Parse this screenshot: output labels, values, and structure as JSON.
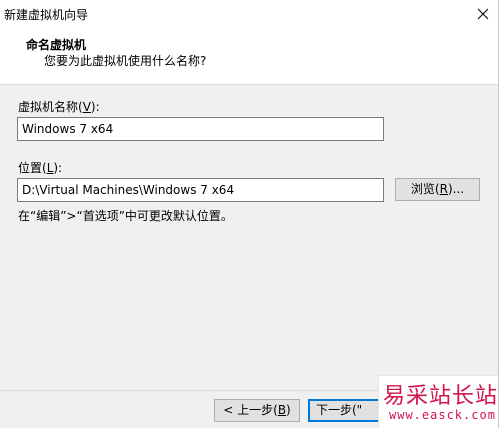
{
  "window": {
    "title": "新建虚拟机向导"
  },
  "header": {
    "title": "命名虚拟机",
    "subtitle": "您要为此虚拟机使用什么名称?"
  },
  "name_field": {
    "label_prefix": "虚拟机名称(",
    "label_key": "V",
    "label_suffix": "):",
    "value": "Windows 7 x64"
  },
  "location_field": {
    "label_prefix": "位置(",
    "label_key": "L",
    "label_suffix": "):",
    "value": "D:\\Virtual Machines\\Windows 7 x64",
    "browse_prefix": "浏览(",
    "browse_key": "R",
    "browse_suffix": ")..."
  },
  "hint": "在“编辑”>“首选项”中可更改默认位置。",
  "footer": {
    "back_prefix": "< 上一步(",
    "back_key": "B",
    "back_suffix": ")",
    "next_visible": "下一步(\""
  },
  "watermark": {
    "brand": "易采站长站",
    "url": "www.easck.com"
  },
  "colors": {
    "accent": "#0078d7",
    "watermark": "#d2144b"
  }
}
